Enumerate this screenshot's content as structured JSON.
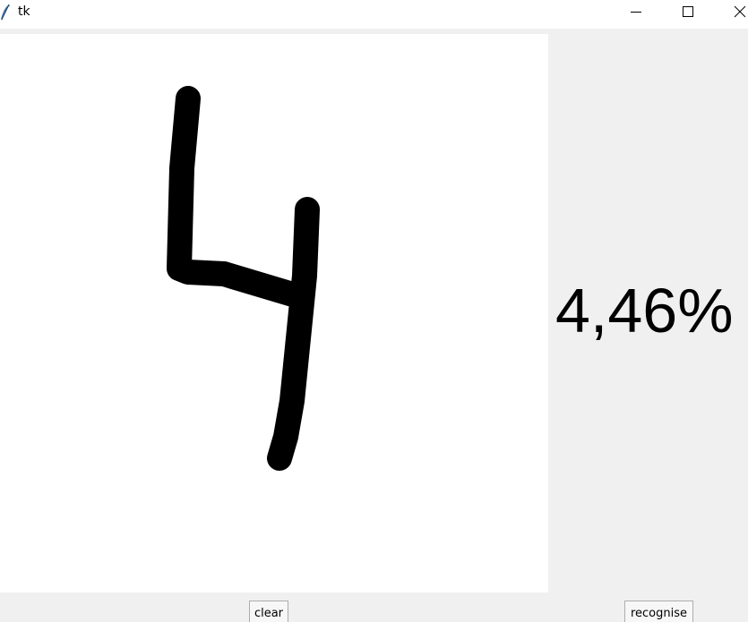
{
  "window": {
    "title": "tk",
    "icon": "feather-icon",
    "controls": [
      "minimize-icon",
      "maximize-icon",
      "close-icon"
    ]
  },
  "canvas": {
    "background": "#ffffff",
    "stroke_color": "#000000",
    "drawing": "handwritten digit"
  },
  "result": {
    "text": "4,46%"
  },
  "buttons": {
    "clear_label": "clear",
    "recognise_label": "recognise"
  }
}
